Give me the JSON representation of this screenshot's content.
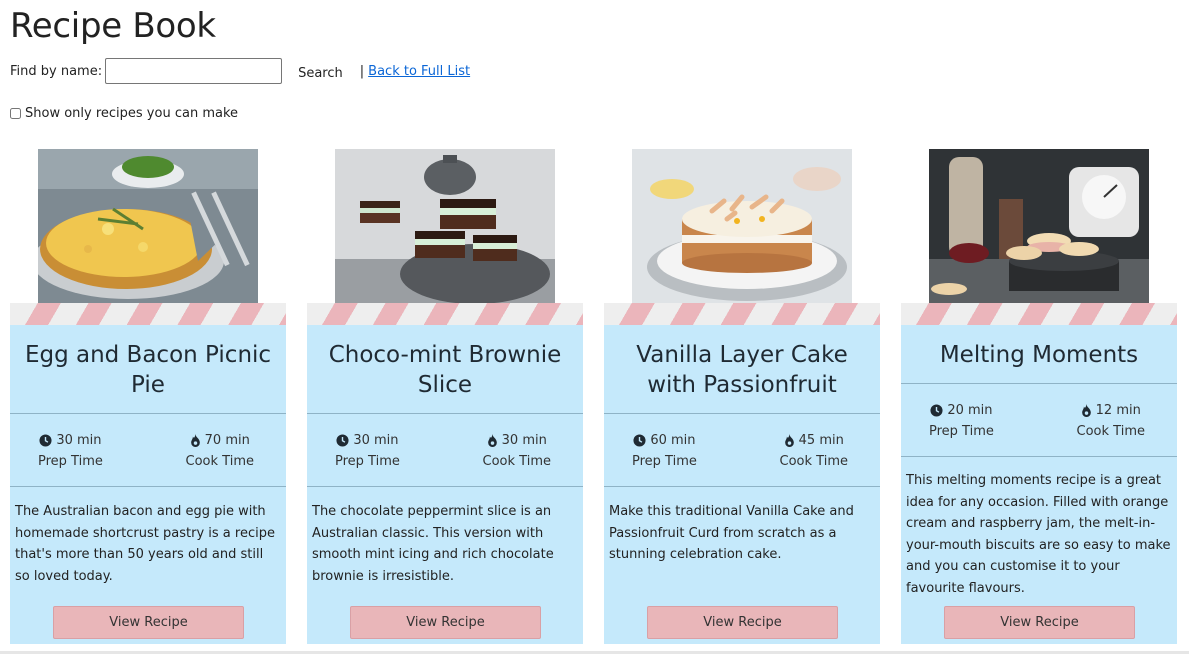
{
  "page": {
    "title": "Recipe Book",
    "find_label": "Find by name:",
    "search_value": "",
    "search_button": "Search",
    "separator": "|",
    "back_link": "Back to Full List",
    "filter_label": "Show only recipes you can make",
    "filter_checked": false
  },
  "theme": {
    "card_background": "#c5e9fb",
    "stripe_pink": "#ebb5bb",
    "button_pink": "#e9b6b9",
    "link_blue": "#0b66d6"
  },
  "icons": {
    "prep": "clock-icon",
    "cook": "flame-icon"
  },
  "recipes": [
    {
      "name": "Egg and Bacon Picnic Pie",
      "prep_value": "30 min",
      "prep_label": "Prep Time",
      "cook_value": "70 min",
      "cook_label": "Cook Time",
      "description": "The Australian bacon and egg pie with homemade shortcrust pastry is a recipe that's more than 50 years old and still so loved today.",
      "button": "View Recipe",
      "image": "egg-and-bacon-pie-photo"
    },
    {
      "name": "Choco-mint Brownie Slice",
      "prep_value": "30 min",
      "prep_label": "Prep Time",
      "cook_value": "30 min",
      "cook_label": "Cook Time",
      "description": "The chocolate peppermint slice is an Australian classic. This version with smooth mint icing and rich chocolate brownie is irresistible.",
      "button": "View Recipe",
      "image": "choco-mint-brownie-photo"
    },
    {
      "name": "Vanilla Layer Cake with Passionfruit",
      "prep_value": "60 min",
      "prep_label": "Prep Time",
      "cook_value": "45 min",
      "cook_label": "Cook Time",
      "description": "Make this traditional Vanilla Cake and Passionfruit Curd from scratch as a stunning celebration cake.",
      "button": "View Recipe",
      "image": "vanilla-layer-cake-photo"
    },
    {
      "name": "Melting Moments",
      "prep_value": "20 min",
      "prep_label": "Prep Time",
      "cook_value": "12 min",
      "cook_label": "Cook Time",
      "description": "This melting moments recipe is a great idea for any occasion. Filled with orange cream and raspberry jam, the melt-in-your-mouth biscuits are so easy to make and you can customise it to your favourite flavours.",
      "button": "View Recipe",
      "image": "melting-moments-photo"
    }
  ]
}
